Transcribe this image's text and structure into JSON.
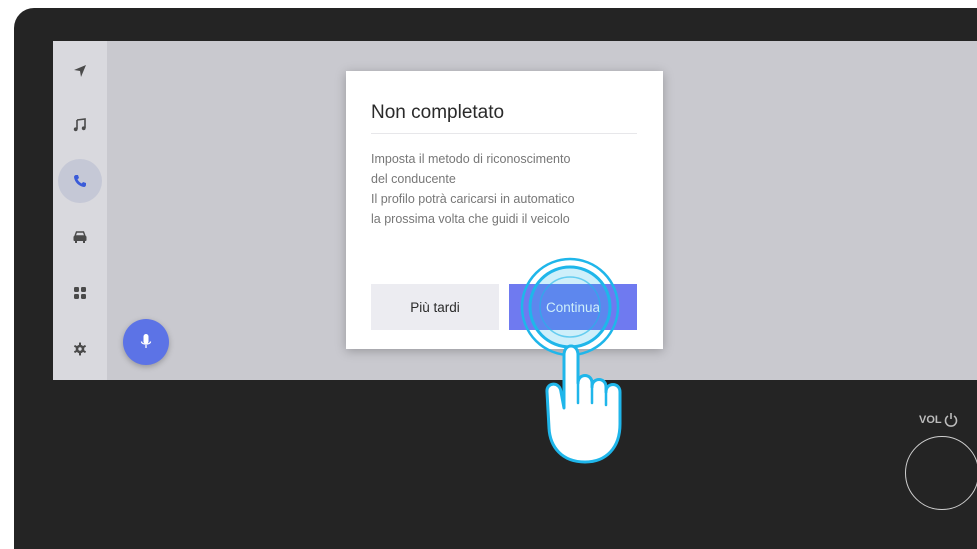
{
  "sidebar": {
    "items": [
      {
        "name": "navigation",
        "icon": "navigation-arrow-icon"
      },
      {
        "name": "music",
        "icon": "music-note-icon"
      },
      {
        "name": "phone",
        "icon": "phone-icon",
        "active": true
      },
      {
        "name": "vehicle",
        "icon": "car-icon"
      },
      {
        "name": "apps",
        "icon": "apps-grid-icon"
      },
      {
        "name": "settings",
        "icon": "gear-icon"
      }
    ]
  },
  "voice_button": {
    "icon": "microphone-icon"
  },
  "dialog": {
    "title": "Non completato",
    "body_lines": [
      "Imposta il metodo di riconoscimento",
      "del conducente",
      "Il profilo potrà caricarsi in automatico",
      "la prossima volta che guidi il veicolo"
    ],
    "later_label": "Più tardi",
    "continue_label": "Continua"
  },
  "hardware": {
    "volume_label": "VOL",
    "volume_icon": "power-icon"
  },
  "colors": {
    "accent": "#6f7af0",
    "mic": "#5c73e6",
    "tap_highlight": "#1fb6ea",
    "bezel": "#242424"
  }
}
